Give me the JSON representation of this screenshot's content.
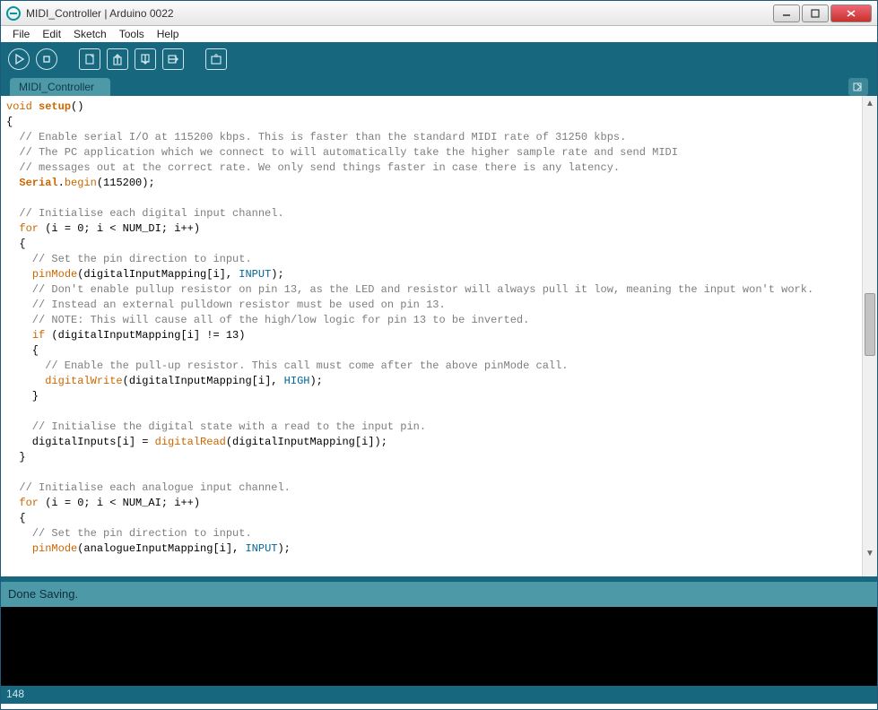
{
  "window": {
    "title": "MIDI_Controller | Arduino 0022"
  },
  "menu": {
    "items": [
      "File",
      "Edit",
      "Sketch",
      "Tools",
      "Help"
    ]
  },
  "tab": {
    "label": "MIDI_Controller"
  },
  "status": {
    "text": "Done Saving."
  },
  "footer": {
    "line": "148"
  },
  "code": {
    "l1a": "void",
    "l1b": "setup",
    "l1c": "()",
    "l2": "{",
    "l3": "  // Enable serial I/O at 115200 kbps. This is faster than the standard MIDI rate of 31250 kbps.",
    "l4": "  // The PC application which we connect to will automatically take the higher sample rate and send MIDI",
    "l5": "  // messages out at the correct rate. We only send things faster in case there is any latency.",
    "l6a": "  ",
    "l6b": "Serial",
    "l6c": ".",
    "l6d": "begin",
    "l6e": "(115200);",
    "l7": "",
    "l8": "  // Initialise each digital input channel.",
    "l9a": "  ",
    "l9b": "for",
    "l9c": " (i = 0; i < NUM_DI; i++)",
    "l10": "  {",
    "l11": "    // Set the pin direction to input.",
    "l12a": "    ",
    "l12b": "pinMode",
    "l12c": "(digitalInputMapping[i], ",
    "l12d": "INPUT",
    "l12e": ");",
    "l13": "    // Don't enable pullup resistor on pin 13, as the LED and resistor will always pull it low, meaning the input won't work.",
    "l14": "    // Instead an external pulldown resistor must be used on pin 13.",
    "l15": "    // NOTE: This will cause all of the high/low logic for pin 13 to be inverted.",
    "l16a": "    ",
    "l16b": "if",
    "l16c": " (digitalInputMapping[i] != 13)",
    "l17": "    {",
    "l18": "      // Enable the pull-up resistor. This call must come after the above pinMode call.",
    "l19a": "      ",
    "l19b": "digitalWrite",
    "l19c": "(digitalInputMapping[i], ",
    "l19d": "HIGH",
    "l19e": ");",
    "l20": "    }",
    "l21": "",
    "l22": "    // Initialise the digital state with a read to the input pin.",
    "l23a": "    digitalInputs[i] = ",
    "l23b": "digitalRead",
    "l23c": "(digitalInputMapping[i]);",
    "l24": "  }",
    "l25": "",
    "l26": "  // Initialise each analogue input channel.",
    "l27a": "  ",
    "l27b": "for",
    "l27c": " (i = 0; i < NUM_AI; i++)",
    "l28": "  {",
    "l29": "    // Set the pin direction to input.",
    "l30a": "    ",
    "l30b": "pinMode",
    "l30c": "(analogueInputMapping[i], ",
    "l30d": "INPUT",
    "l30e": ");"
  }
}
